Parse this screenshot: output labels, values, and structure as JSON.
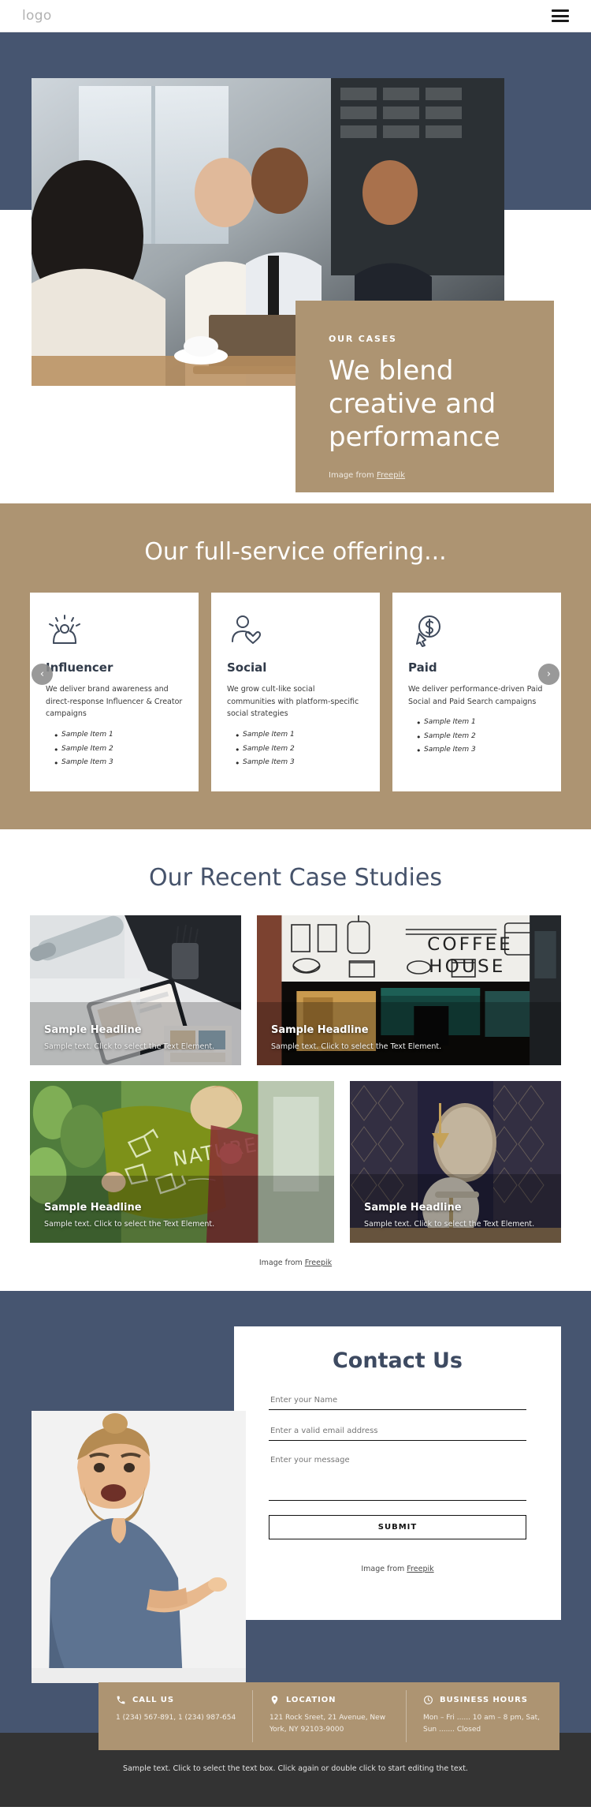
{
  "header": {
    "logo": "logo",
    "menu_icon": "hamburger-menu-icon"
  },
  "hero": {
    "eyebrow": "OUR CASES",
    "title": "We blend creative and performance",
    "credit_prefix": "Image from ",
    "credit_link": "Freepik"
  },
  "offering": {
    "heading": "Our full-service offering...",
    "prev_label": "‹",
    "next_label": "›",
    "cards": [
      {
        "icon": "celebration-person-icon",
        "title": "Influencer",
        "description": "We deliver brand awareness and direct-response Influencer & Creator campaigns",
        "items": [
          "Sample Item 1",
          "Sample Item 2",
          "Sample Item 3"
        ]
      },
      {
        "icon": "person-heart-icon",
        "title": "Social",
        "description": "We grow cult-like social communities with platform-specific social strategies",
        "items": [
          "Sample Item 1",
          "Sample Item 2",
          "Sample Item 3"
        ]
      },
      {
        "icon": "dollar-click-icon",
        "title": "Paid",
        "description": "We deliver performance-driven Paid Social and Paid Search campaigns",
        "items": [
          "Sample Item 1",
          "Sample Item 2",
          "Sample Item 3"
        ]
      }
    ]
  },
  "cases": {
    "heading": "Our Recent Case Studies",
    "tiles": [
      {
        "headline": "Sample Headline",
        "text": "Sample text. Click to select the Text Element."
      },
      {
        "headline": "Sample Headline",
        "text": "Sample text. Click to select the Text Element."
      },
      {
        "headline": "Sample Headline",
        "text": "Sample text. Click to select the Text Element."
      },
      {
        "headline": "Sample Headline",
        "text": "Sample text. Click to select the Text Element."
      }
    ],
    "credit_prefix": "Image from ",
    "credit_link": "Freepik"
  },
  "contact": {
    "heading": "Contact Us",
    "name_placeholder": "Enter your Name",
    "email_placeholder": "Enter a valid email address",
    "message_placeholder": "Enter your message",
    "submit_label": "SUBMIT",
    "credit_prefix": "Image from ",
    "credit_link": "Freepik",
    "info": [
      {
        "icon": "phone-icon",
        "title": "CALL US",
        "text": "1 (234) 567-891, 1 (234) 987-654"
      },
      {
        "icon": "map-pin-icon",
        "title": "LOCATION",
        "text": "121 Rock Sreet, 21 Avenue, New York, NY 92103-9000"
      },
      {
        "icon": "clock-icon",
        "title": "BUSINESS HOURS",
        "text": "Mon – Fri ...... 10 am – 8 pm, Sat, Sun ....... Closed"
      }
    ]
  },
  "footer": {
    "text": "Sample text. Click to select the text box. Click again or double click to start editing the text."
  },
  "colors": {
    "navy": "#465570",
    "tan": "#ad9472",
    "dark_footer": "#333333",
    "heading_blue": "#46536b"
  }
}
